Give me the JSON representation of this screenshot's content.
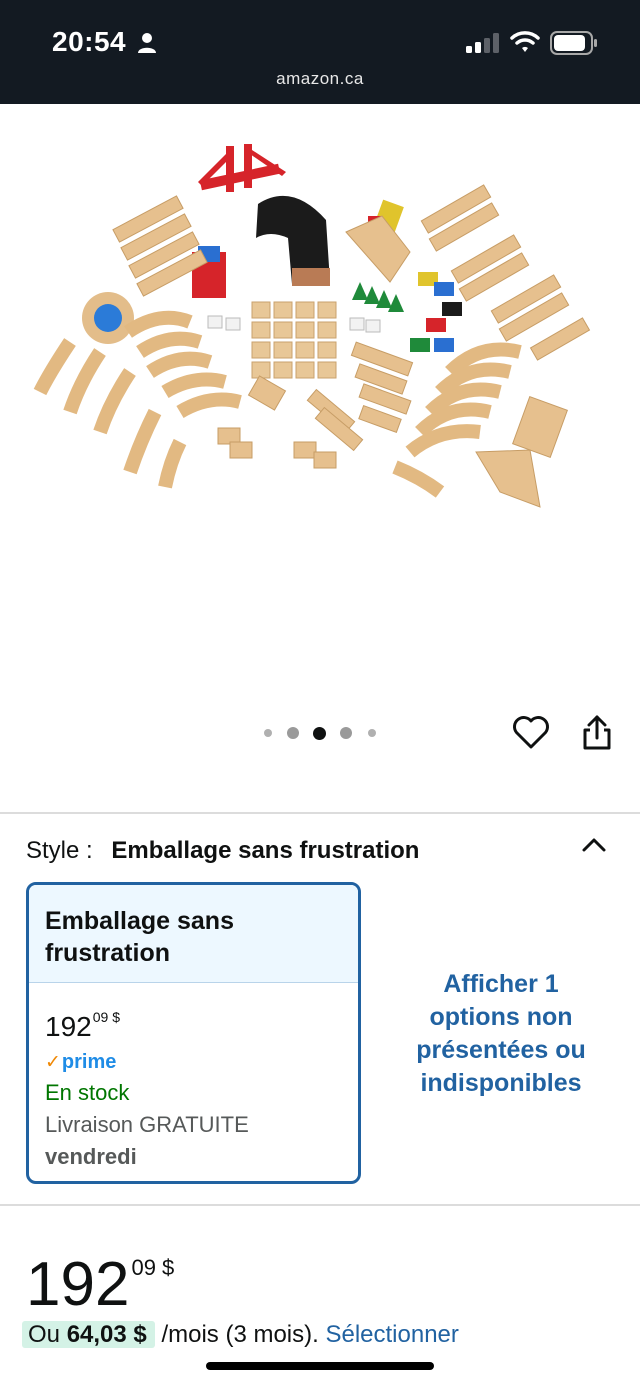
{
  "status_bar": {
    "time": "20:54",
    "url": "amazon.ca",
    "icons": [
      "person-icon",
      "signal-icon",
      "wifi-icon",
      "battery-icon"
    ]
  },
  "gallery": {
    "image_alt": "Wooden train set pieces",
    "page_count": 5,
    "active_index": 2,
    "icons": [
      "heart-icon",
      "share-icon"
    ]
  },
  "style_selector": {
    "label": "Style :",
    "selected_value": "Emballage sans frustration",
    "icon": "chevron-up-icon",
    "option": {
      "title": "Emballage sans frustration",
      "price_whole": "192",
      "price_fraction": "09",
      "price_currency": "$",
      "prime": "prime",
      "stock": "En stock",
      "delivery": "Livraison GRATUITE",
      "delivery_day": "vendredi"
    },
    "more_options_link": "Afficher 1 options non présentées ou indisponibles"
  },
  "price": {
    "whole": "192",
    "fraction": "09",
    "currency": "$"
  },
  "installment": {
    "prefix": "Ou",
    "amount": "64,03 $",
    "suffix": "/mois (3 mois).",
    "link": "Sélectionner"
  },
  "colors": {
    "status_bar_bg": "#131a22",
    "link_blue": "#2162a1",
    "card_head_bg": "#edf8ff",
    "stock_green": "#007600",
    "prime_blue": "#1f8ce6",
    "prime_check_orange": "#f08804",
    "installment_highlight": "#d4f2e6"
  }
}
